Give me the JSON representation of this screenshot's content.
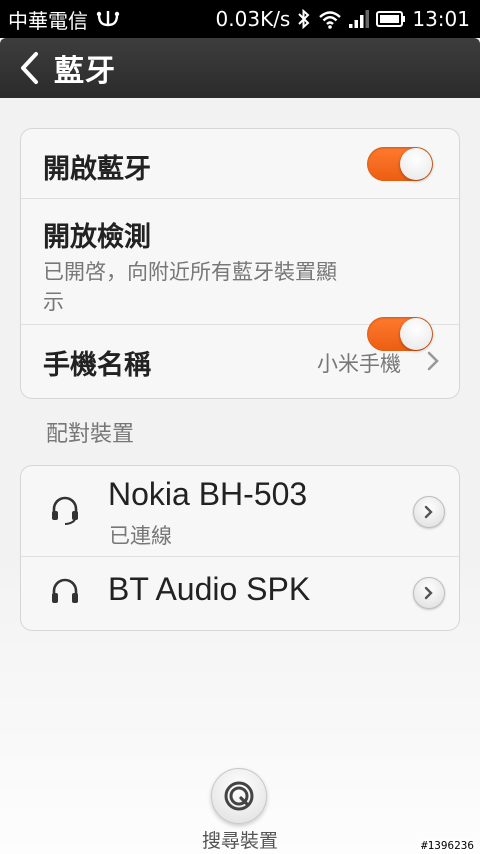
{
  "status_bar": {
    "carrier": "中華電信",
    "speed": "0.03K/s",
    "time": "13:01"
  },
  "header": {
    "title": "藍牙"
  },
  "bluetooth_settings": {
    "enable_label": "開啟藍牙",
    "enable_on": true,
    "discoverable_label": "開放檢測",
    "discoverable_sub": "已開啓，向附近所有藍牙裝置顯示",
    "discoverable_on": true,
    "device_name_label": "手機名稱",
    "device_name_value": "小米手機"
  },
  "paired_section_label": "配對裝置",
  "paired_devices": [
    {
      "name": "Nokia BH-503",
      "status": "已連線",
      "icon": "headset-icon"
    },
    {
      "name": "BT Audio SPK",
      "status": "",
      "icon": "headphones-icon"
    }
  ],
  "search_button_label": "搜尋裝置",
  "watermark": "#1396236",
  "colors": {
    "toggle_on": "#f26a1f",
    "header_bg": "#333333",
    "status_bg": "#000000"
  }
}
